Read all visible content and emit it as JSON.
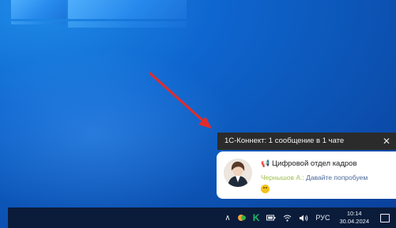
{
  "notification": {
    "title": "1С-Коннект: 1 сообщение в 1 чате",
    "close_glyph": "✕",
    "chat_icon": "📢",
    "chat_name": "Цифровой отдел кадров",
    "sender": "Чернышов А.:",
    "message": " Давайте попробуем",
    "emoji": "smiling-face-icon"
  },
  "taskbar": {
    "tray_chevron": "∧",
    "kaspersky_label": "K",
    "language": "РУС",
    "time": "10:14",
    "date": "30.04.2024"
  },
  "colors": {
    "arrow": "#e12c2c",
    "notification_title_bg": "#2b2b2b",
    "sender": "#9ec24a",
    "taskbar": "#0b1c3a"
  }
}
